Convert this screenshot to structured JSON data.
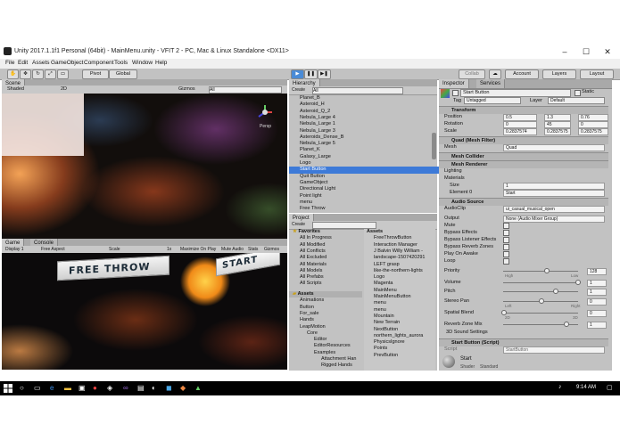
{
  "window": {
    "title": "Unity 2017.1.1f1 Personal (64bit) - MainMenu.unity - VFIT 2 - PC, Mac & Linux Standalone <DX11>"
  },
  "menubar": [
    "File",
    "Edit",
    "Assets",
    "GameObject",
    "Component",
    "Tools",
    "Window",
    "Help"
  ],
  "toolbar": {
    "pivot": "Pivot",
    "global": "Global",
    "collab": "Collab",
    "account": "Account",
    "layers": "Layers",
    "layout": "Layout"
  },
  "scene": {
    "tab": "Scene",
    "shaded": "Shaded",
    "mode_2d": "2D",
    "gizmos": "Gizmos",
    "search": "All",
    "persp": "Persp"
  },
  "game": {
    "tab": "Game",
    "console_tab": "Console",
    "display": "Display 1",
    "aspect": "Free Aspect",
    "scale_label": "Scale",
    "scale_value": "1x",
    "maximize": "Maximize On Play",
    "mute": "Mute Audio",
    "stats": "Stats",
    "gizmos": "Gizmos",
    "free_throw": "FREE THROW",
    "start": "START"
  },
  "hierarchy": {
    "tab": "Hierarchy",
    "create": "Create",
    "search": "All",
    "items": [
      "Planet_B",
      "Asteroid_H",
      "Asteroid_Q_2",
      "Nebula_Large 4",
      "Nebula_Large 1",
      "Nebula_Large 3",
      "Asteroids_Dense_B",
      "Nebula_Large 5",
      "Planet_K",
      "Galaxy_Large",
      "Logo",
      "Start Button",
      "Quit Button",
      "GameObject",
      "Directional Light",
      "Point light",
      "menu",
      "Free Throw"
    ],
    "selected": "Start Button"
  },
  "project": {
    "tab": "Project",
    "create": "Create",
    "favorites_label": "Favorites",
    "favorites": [
      "All In Progress",
      "All Modified",
      "All Conflicts",
      "All Excluded",
      "All Materials",
      "All Models",
      "All Prefabs",
      "All Scripts"
    ],
    "assets_label": "Assets",
    "folders": [
      "Animations",
      "Button",
      "For_sale",
      "Hands",
      "LeapMotion",
      "Core",
      "Editor",
      "EditorResources",
      "Examples",
      "Attachment Han",
      "Rigged Hands"
    ],
    "breadcrumb": "Assets",
    "assets": [
      "FreeThrowButton",
      "Interaction Manager",
      "J Balvin Willy William -",
      "landscape-1507420291",
      "LEFT grasp",
      "like-the-northern-lights",
      "Logo",
      "Magenta",
      "MainMenu",
      "MainMenuButton",
      "menu",
      "menu",
      "Mountain",
      "New Terrain",
      "NextButton",
      "northern_lights_aurora",
      "PhysicsIgnore",
      "Points",
      "PrevButton"
    ]
  },
  "inspector": {
    "tab": "Inspector",
    "services_tab": "Services",
    "object_name": "Start Button",
    "static": "Static",
    "tag_label": "Tag",
    "tag": "Untagged",
    "layer_label": "Layer",
    "layer": "Default",
    "transform": {
      "title": "Transform",
      "position_label": "Position",
      "rotation_label": "Rotation",
      "scale_label": "Scale",
      "pos": {
        "x": "0.5",
        "y": "1.3",
        "z": "0.76"
      },
      "rot": {
        "x": "0",
        "y": "45",
        "z": "0"
      },
      "scl": {
        "x": "0.2837574",
        "y": "0.2837575",
        "z": "0.2837575"
      }
    },
    "mesh_filter": {
      "title": "Quad (Mesh Filter)",
      "mesh_label": "Mesh",
      "mesh": "Quad"
    },
    "mesh_collider": {
      "title": "Mesh Collider"
    },
    "mesh_renderer": {
      "title": "Mesh Renderer",
      "lighting": "Lighting",
      "materials": "Materials",
      "size_label": "Size",
      "size": "1",
      "element_label": "Element 0",
      "element": "Start"
    },
    "audio": {
      "title": "Audio Source",
      "clip_label": "AudioClip",
      "clip": "ui_casual_musical_open",
      "output_label": "Output",
      "output": "None (Audio Mixer Group)",
      "mute": "Mute",
      "bypass": "Bypass Effects",
      "bypass_listener": "Bypass Listener Effects",
      "bypass_reverb": "Bypass Reverb Zones",
      "play_awake": "Play On Awake",
      "loop": "Loop",
      "priority_label": "Priority",
      "priority": "128",
      "high": "High",
      "low": "Low",
      "volume_label": "Volume",
      "volume": "1",
      "pitch_label": "Pitch",
      "pitch": "1",
      "stereo_label": "Stereo Pan",
      "stereo": "0",
      "left": "Left",
      "right": "Right",
      "spatial_label": "Spatial Blend",
      "spatial": "0",
      "two_d": "2D",
      "three_d": "3D",
      "reverb_label": "Reverb Zone Mix",
      "reverb": "1",
      "sound3d": "3D Sound Settings"
    },
    "script": {
      "title": "Start Button (Script)",
      "script_label": "Script",
      "script": "StartButton"
    },
    "material": {
      "name": "Start",
      "shader_label": "Shader",
      "shader": "Standard"
    }
  },
  "taskbar": {
    "time": "9:14 AM",
    "date": "10/2/2017"
  },
  "colors": {
    "selection": "#3d7ad8",
    "panel": "#c2c2c2",
    "taskbar": "#000000"
  }
}
